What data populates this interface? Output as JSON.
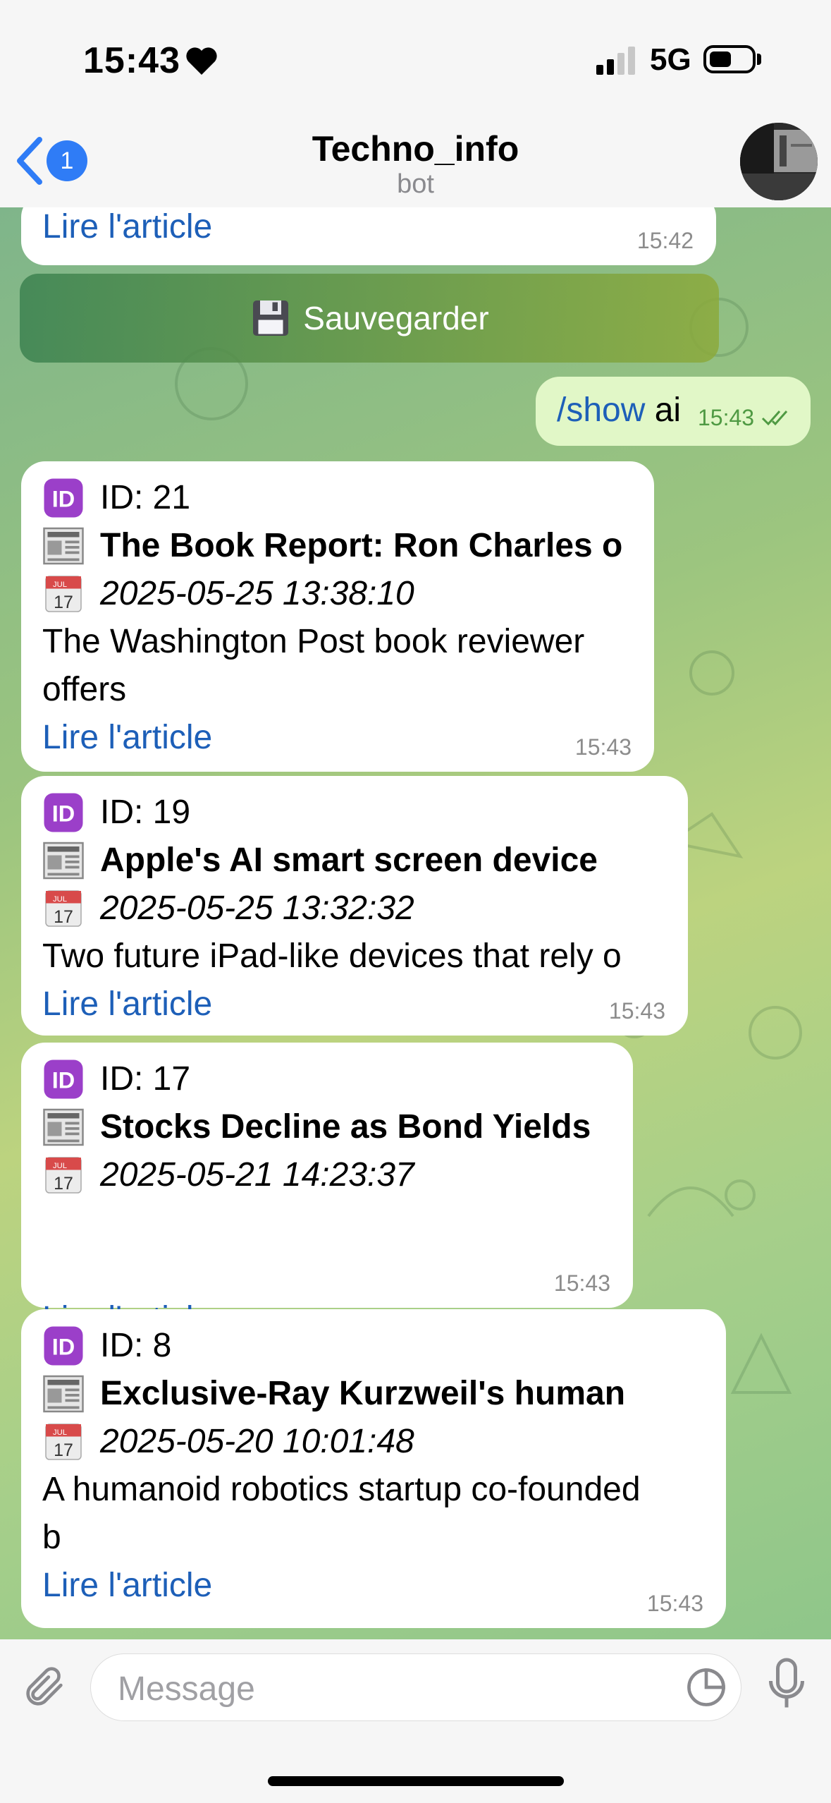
{
  "status": {
    "time": "15:43",
    "network": "5G"
  },
  "header": {
    "title": "Techno_info",
    "subtitle": "bot",
    "back_badge": "1"
  },
  "top_message": {
    "link": "Lire l'article",
    "time": "15:42"
  },
  "save_button": {
    "icon": "floppy-disk-icon",
    "label": "Sauvegarder"
  },
  "outgoing": {
    "command": "/show",
    "arg": "ai",
    "time": "15:43",
    "status": "read-double-check"
  },
  "articles": [
    {
      "id": "ID: 21",
      "title": "The Book Report: Ron Charles o",
      "date": "2025-05-25 13:38:10",
      "desc": "The Washington Post book reviewer offers",
      "link": "Lire l'article",
      "time": "15:43"
    },
    {
      "id": "ID: 19",
      "title": "Apple's AI smart screen device",
      "date": "2025-05-25 13:32:32",
      "desc": "Two future iPad-like devices that rely o",
      "link": "Lire l'article",
      "time": "15:43"
    },
    {
      "id": "ID: 17",
      "title": "Stocks Decline as Bond Yields",
      "date": "2025-05-21 14:23:37",
      "desc": "",
      "link": "Lire l'article",
      "time": "15:43"
    },
    {
      "id": "ID: 8",
      "title": "Exclusive-Ray Kurzweil's human",
      "date": "2025-05-20 10:01:48",
      "desc": "A humanoid robotics startup co-founded b",
      "link": "Lire l'article",
      "time": "15:43"
    }
  ],
  "calendar_icon_text": {
    "month": "JUL",
    "day": "17"
  },
  "id_icon_text": "ID",
  "input": {
    "placeholder": "Message"
  },
  "colors": {
    "link": "#1d5fb8",
    "outgoing_bubble": "#e1f7c7",
    "save_button": "#6fa05c",
    "badge": "#2f7cf6"
  }
}
